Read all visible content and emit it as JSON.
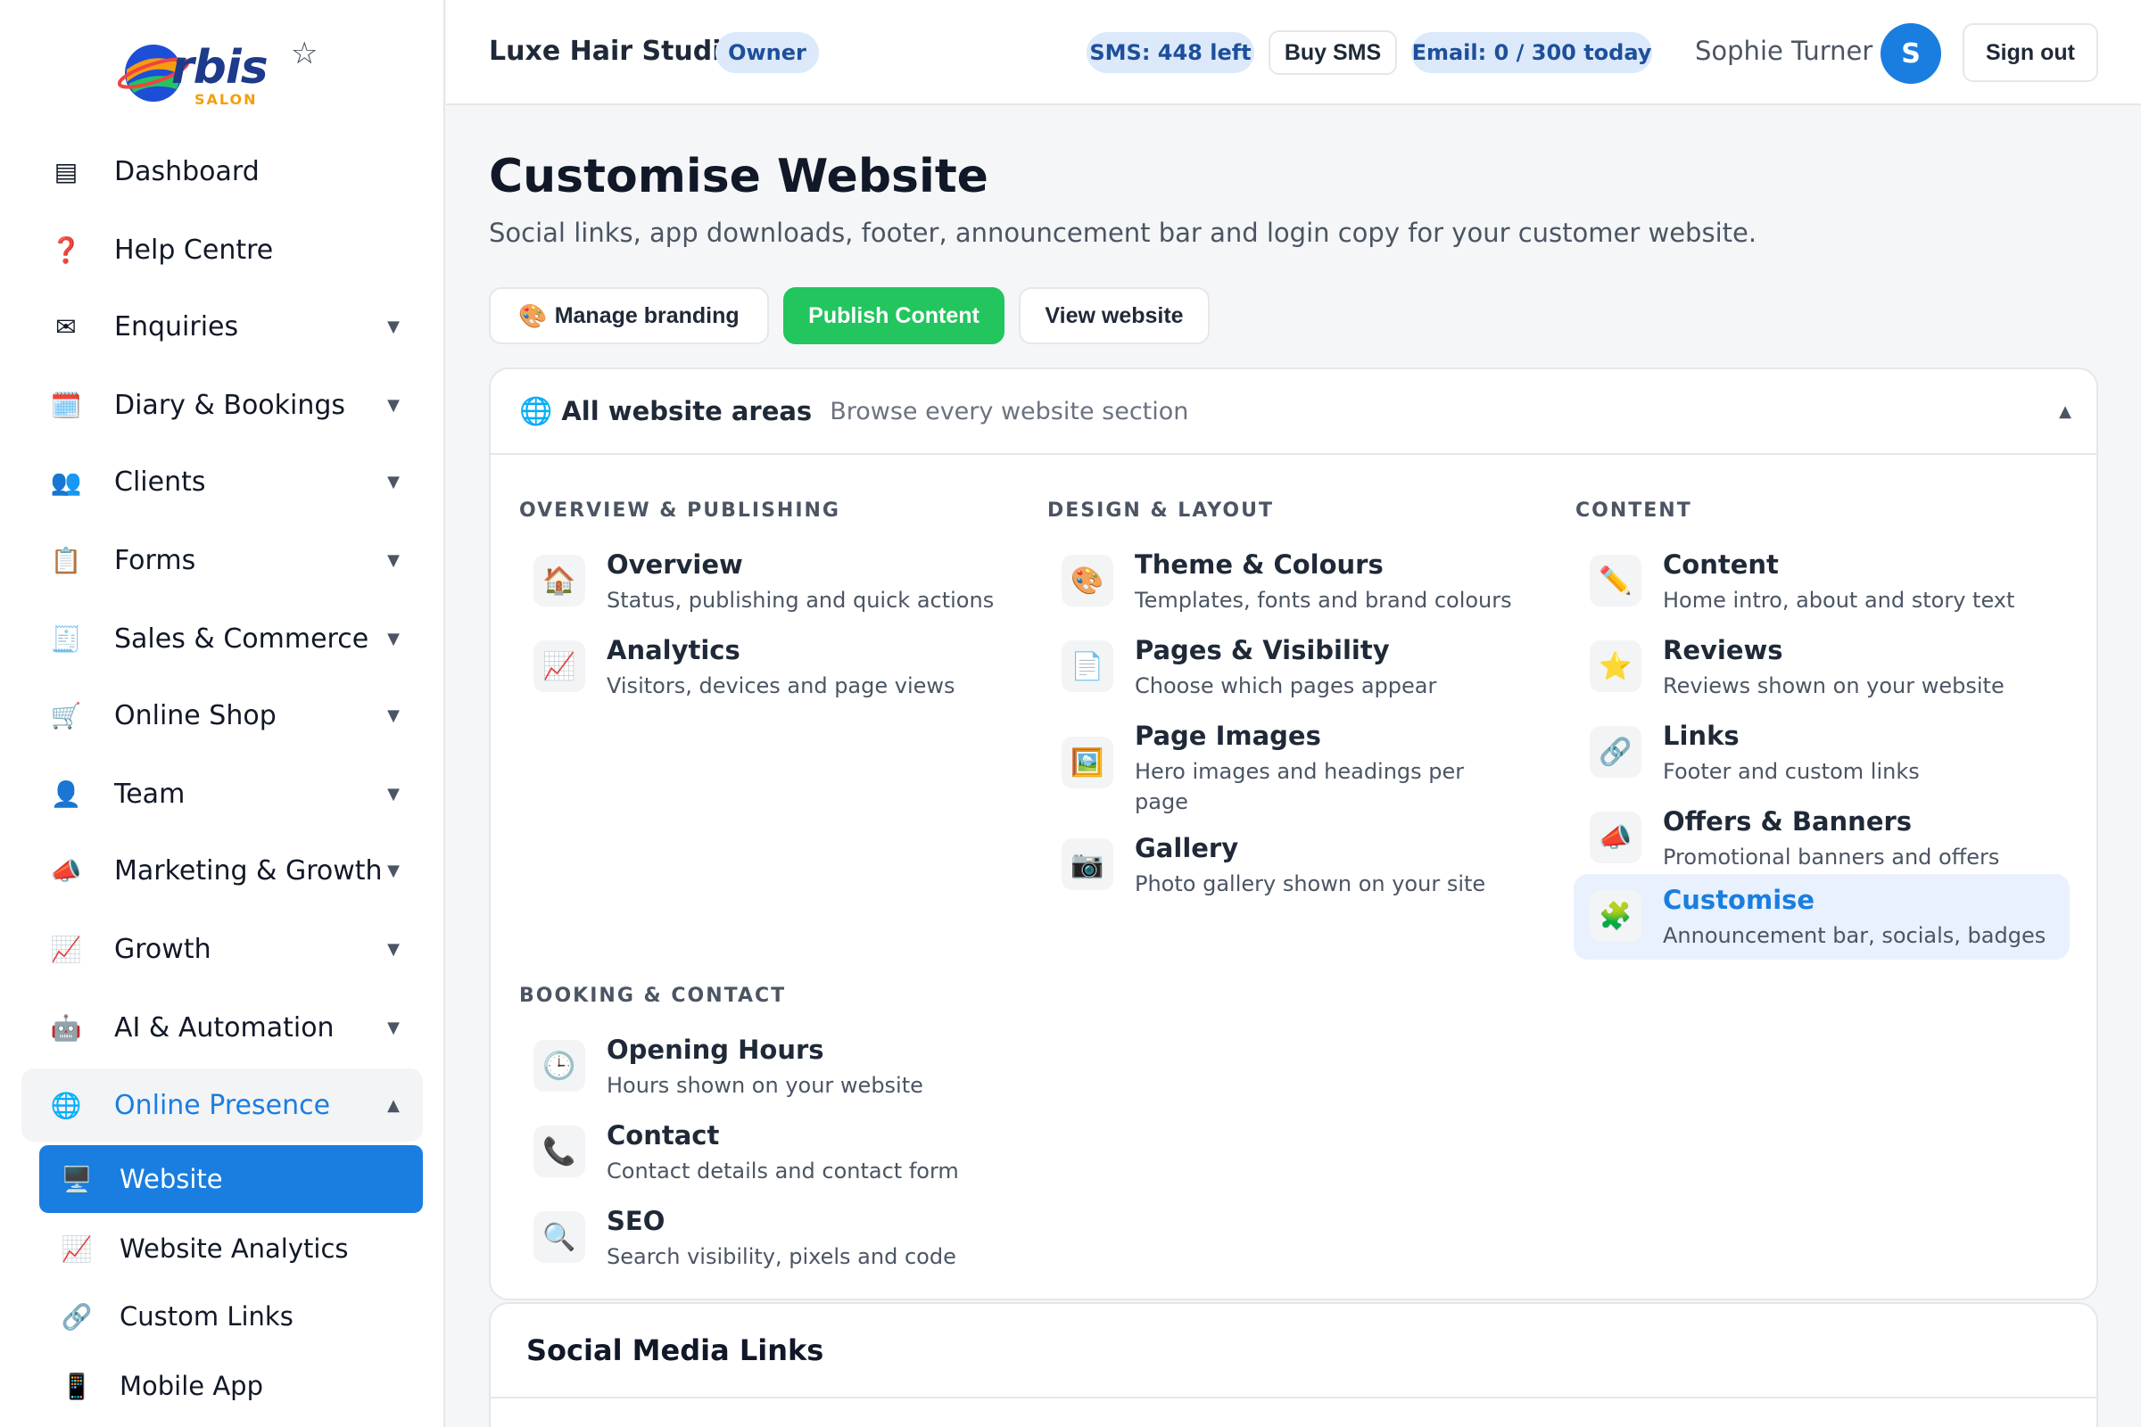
{
  "brand": {
    "logo_text": "rbis",
    "logo_sub": "SALON"
  },
  "sidebar": {
    "items": [
      {
        "icon": "▤",
        "label": "Dashboard"
      },
      {
        "icon": "❓",
        "label": "Help Centre"
      },
      {
        "icon": "✉",
        "label": "Enquiries",
        "caret": "▼"
      },
      {
        "icon": "🗓️",
        "label": "Diary & Bookings",
        "caret": "▼"
      },
      {
        "icon": "👥",
        "label": "Clients",
        "caret": "▼"
      },
      {
        "icon": "📋",
        "label": "Forms",
        "caret": "▼"
      },
      {
        "icon": "🧾",
        "label": "Sales & Commerce",
        "caret": "▼"
      },
      {
        "icon": "🛒",
        "label": "Online Shop",
        "caret": "▼"
      },
      {
        "icon": "👤",
        "label": "Team",
        "caret": "▼"
      },
      {
        "icon": "📣",
        "label": "Marketing & Growth",
        "caret": "▼"
      },
      {
        "icon": "📈",
        "label": "Growth",
        "caret": "▼"
      },
      {
        "icon": "🤖",
        "label": "AI & Automation",
        "caret": "▼"
      },
      {
        "icon": "🌐",
        "label": "Online Presence",
        "caret": "▲"
      }
    ],
    "subitems": [
      {
        "icon": "🖥️",
        "label": "Website"
      },
      {
        "icon": "📈",
        "label": "Website Analytics"
      },
      {
        "icon": "🔗",
        "label": "Custom Links"
      },
      {
        "icon": "📱",
        "label": "Mobile App"
      }
    ]
  },
  "topbar": {
    "studio": "Luxe Hair Studio",
    "role": "Owner",
    "sms": "SMS: 448 left",
    "buy_sms": "Buy SMS",
    "email": "Email: 0 / 300 today",
    "user_name": "Sophie Turner",
    "avatar_letter": "S",
    "sign_out": "Sign out"
  },
  "page": {
    "title": "Customise Website",
    "subtitle": "Social links, app downloads, footer, announcement bar and login copy for your customer website.",
    "actions": {
      "manage_icon": "🎨",
      "manage": "Manage branding",
      "publish": "Publish Content",
      "view": "View website"
    }
  },
  "areas": {
    "header_icon": "🌐",
    "title": "All website areas",
    "subtitle": "Browse every website section",
    "toggle": "▲",
    "groups": {
      "overview": {
        "title": "OVERVIEW & PUBLISHING",
        "items": [
          {
            "icon": "🏠",
            "name": "Overview",
            "desc": "Status, publishing and quick actions"
          },
          {
            "icon": "📈",
            "name": "Analytics",
            "desc": "Visitors, devices and page views"
          }
        ]
      },
      "design": {
        "title": "DESIGN & LAYOUT",
        "items": [
          {
            "icon": "🎨",
            "name": "Theme & Colours",
            "desc": "Templates, fonts and brand colours"
          },
          {
            "icon": "📄",
            "name": "Pages & Visibility",
            "desc": "Choose which pages appear"
          },
          {
            "icon": "🖼️",
            "name": "Page Images",
            "desc": "Hero images and headings per page"
          },
          {
            "icon": "📷",
            "name": "Gallery",
            "desc": "Photo gallery shown on your site"
          }
        ]
      },
      "content": {
        "title": "CONTENT",
        "items": [
          {
            "icon": "✏️",
            "name": "Content",
            "desc": "Home intro, about and story text"
          },
          {
            "icon": "⭐",
            "name": "Reviews",
            "desc": "Reviews shown on your website"
          },
          {
            "icon": "🔗",
            "name": "Links",
            "desc": "Footer and custom links"
          },
          {
            "icon": "📣",
            "name": "Offers & Banners",
            "desc": "Promotional banners and offers"
          },
          {
            "icon": "🧩",
            "name": "Customise",
            "desc": "Announcement bar, socials, badges"
          }
        ]
      },
      "booking": {
        "title": "BOOKING & CONTACT",
        "items": [
          {
            "icon": "🕒",
            "name": "Opening Hours",
            "desc": "Hours shown on your website"
          },
          {
            "icon": "📞",
            "name": "Contact",
            "desc": "Contact details and contact form"
          },
          {
            "icon": "🔍",
            "name": "SEO",
            "desc": "Search visibility, pixels and code"
          }
        ]
      }
    }
  },
  "social": {
    "title": "Social Media Links"
  },
  "colors": {
    "accent": "#1a7ee0",
    "publish": "#22c55e",
    "pill_bg": "#dbe9fb",
    "pill_text": "#1e4f9a"
  }
}
